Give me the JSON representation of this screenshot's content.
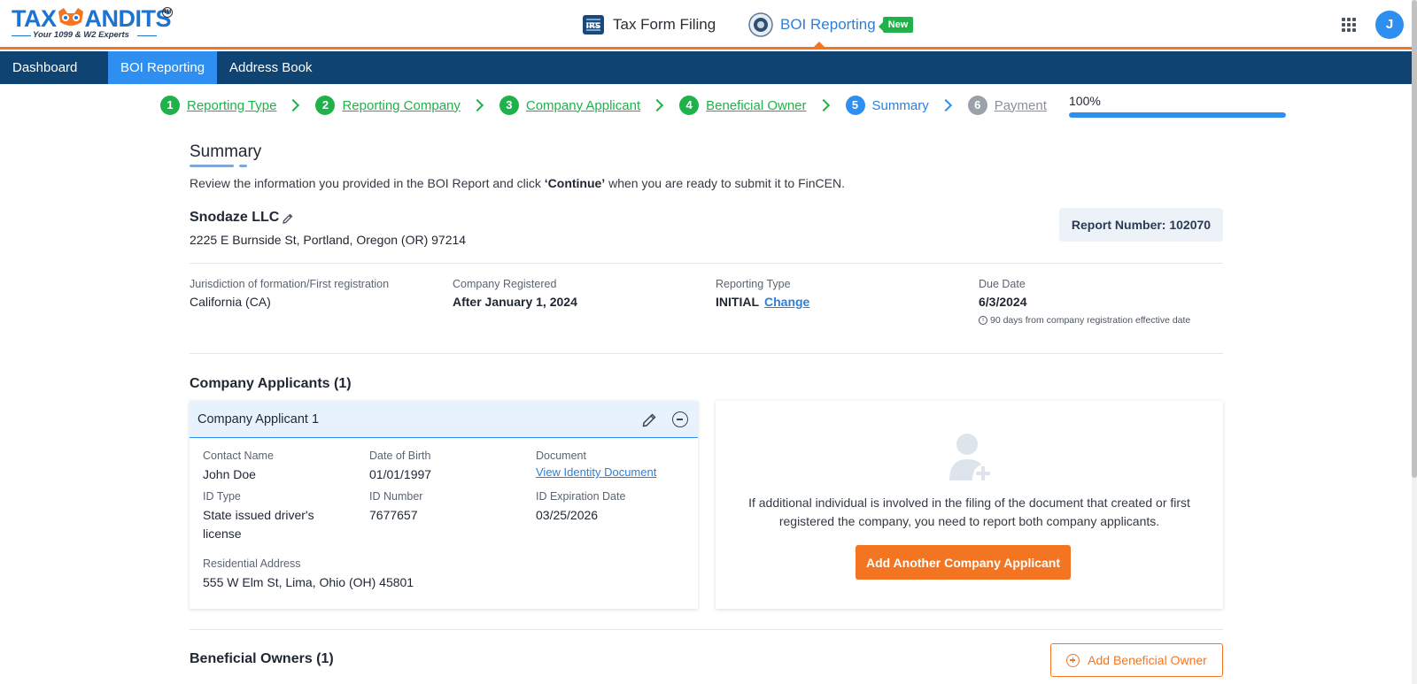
{
  "header": {
    "logo_prefix": "TAX",
    "logo_suffix": "ANDITS",
    "logo_tagline": "Your 1099 & W2 Experts",
    "logo_tm": "TM",
    "tax_form_filing": "Tax Form Filing",
    "boi_reporting": "BOI Reporting",
    "new_badge": "New",
    "avatar_initial": "J",
    "accent_color": "#f47521",
    "brand_color": "#1b74d2"
  },
  "nav": {
    "items": [
      {
        "label": "Dashboard"
      },
      {
        "label": "BOI Reporting"
      },
      {
        "label": "Address Book"
      }
    ]
  },
  "stepper": {
    "steps": [
      {
        "num": "1",
        "label": "Reporting Type",
        "state": "done"
      },
      {
        "num": "2",
        "label": "Reporting Company",
        "state": "done"
      },
      {
        "num": "3",
        "label": "Company Applicant",
        "state": "done"
      },
      {
        "num": "4",
        "label": "Beneficial Owner",
        "state": "done"
      },
      {
        "num": "5",
        "label": "Summary",
        "state": "current"
      },
      {
        "num": "6",
        "label": "Payment",
        "state": "todo"
      }
    ],
    "progress_label": "100%",
    "progress_value": 100
  },
  "summary": {
    "title": "Summary",
    "desc_before": "Review the information you provided in the BOI Report and click ",
    "desc_bold": "‘Continue’",
    "desc_after": " when you are ready to submit it to FinCEN.",
    "company_name": "Snodaze LLC",
    "company_address": "2225 E Burnside St, Portland, Oregon (OR) 97214",
    "report_number": "Report Number: 102070",
    "jurisdiction_label": "Jurisdiction of formation/First registration",
    "jurisdiction_value": "California (CA)",
    "registered_label": "Company Registered",
    "registered_value": "After January 1, 2024",
    "reporting_type_label": "Reporting Type",
    "reporting_type_value": "INITIAL",
    "change_link": "Change",
    "due_date_label": "Due Date",
    "due_date_value": "6/3/2024",
    "due_note": "90 days from company registration effective date"
  },
  "company_applicants": {
    "heading": "Company Applicants (1)",
    "card": {
      "title": "Company Applicant 1",
      "contact_name_label": "Contact Name",
      "contact_name": "John Doe",
      "dob_label": "Date of Birth",
      "dob": "01/01/1997",
      "document_label": "Document",
      "document_link": "View Identity Document",
      "id_type_label": "ID Type",
      "id_type": "State issued driver's license",
      "id_number_label": "ID Number",
      "id_number": "7677657",
      "id_exp_label": "ID Expiration Date",
      "id_exp": "03/25/2026",
      "address_label": "Residential Address",
      "address": "555 W Elm St, Lima, Ohio (OH) 45801"
    },
    "add_text": "If additional individual is involved in the filing of the document that created or first registered the company, you need to report both company applicants.",
    "add_button": "Add Another Company Applicant"
  },
  "beneficial_owners": {
    "heading": "Beneficial Owners (1)",
    "add_button": "Add Beneficial Owner"
  }
}
